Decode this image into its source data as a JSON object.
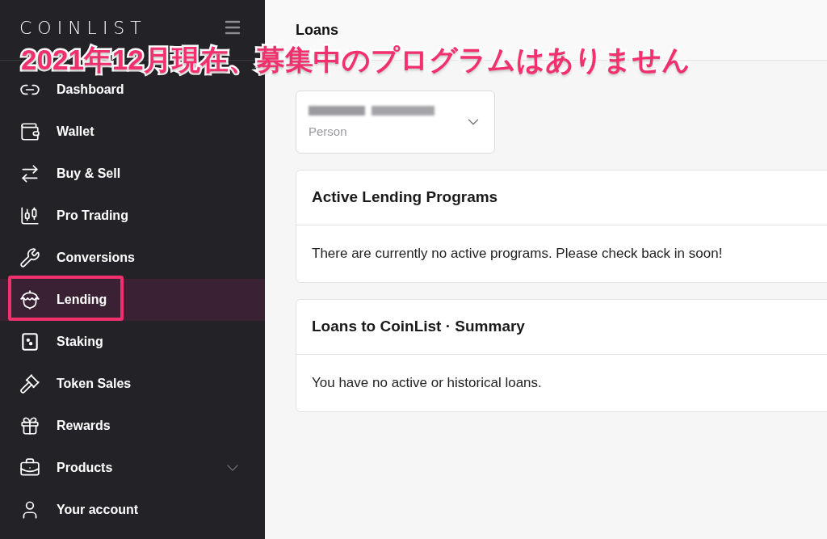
{
  "sidebar": {
    "logo": "COINLIST",
    "items": [
      {
        "label": "Dashboard",
        "selected": false,
        "highlighted": false,
        "kind": "link"
      },
      {
        "label": "Wallet",
        "selected": false,
        "highlighted": false,
        "kind": "link"
      },
      {
        "label": "Buy & Sell",
        "selected": false,
        "highlighted": false,
        "kind": "link"
      },
      {
        "label": "Pro Trading",
        "selected": false,
        "highlighted": false,
        "kind": "link"
      },
      {
        "label": "Conversions",
        "selected": false,
        "highlighted": false,
        "kind": "link"
      },
      {
        "label": "Lending",
        "selected": true,
        "highlighted": true,
        "kind": "link"
      },
      {
        "label": "Staking",
        "selected": false,
        "highlighted": false,
        "kind": "link"
      },
      {
        "label": "Token Sales",
        "selected": false,
        "highlighted": false,
        "kind": "link"
      },
      {
        "label": "Rewards",
        "selected": false,
        "highlighted": false,
        "kind": "link"
      },
      {
        "label": "Products",
        "selected": false,
        "highlighted": false,
        "kind": "group"
      },
      {
        "label": "Your account",
        "selected": false,
        "highlighted": false,
        "kind": "link"
      }
    ]
  },
  "page": {
    "title": "Loans",
    "account_select": {
      "sublabel": "Person"
    },
    "cards": [
      {
        "title": "Active Lending Programs",
        "body": "There are currently no active programs. Please check back in soon!"
      },
      {
        "title": "Loans to CoinList · Summary",
        "body": "You have no active or historical loans."
      }
    ]
  },
  "annotation": {
    "text": "2021年12月現在、募集中のプログラムはありません"
  }
}
